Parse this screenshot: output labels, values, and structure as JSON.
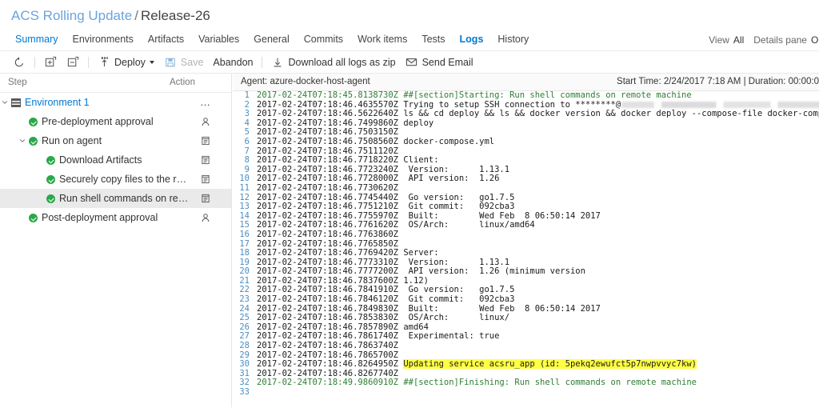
{
  "breadcrumb": {
    "project": "ACS Rolling Update",
    "separator": "/",
    "current": "Release-26"
  },
  "tabs": [
    {
      "label": "Summary",
      "state": "link"
    },
    {
      "label": "Environments",
      "state": "normal"
    },
    {
      "label": "Artifacts",
      "state": "normal"
    },
    {
      "label": "Variables",
      "state": "normal"
    },
    {
      "label": "General",
      "state": "normal"
    },
    {
      "label": "Commits",
      "state": "normal"
    },
    {
      "label": "Work items",
      "state": "normal"
    },
    {
      "label": "Tests",
      "state": "normal"
    },
    {
      "label": "Logs",
      "state": "active"
    },
    {
      "label": "History",
      "state": "normal"
    }
  ],
  "tab_right": {
    "view_label": "View",
    "view_value": "All",
    "details_pane_label": "Details pane",
    "details_pane_value": "On"
  },
  "toolbar": {
    "refresh_icon": "refresh-icon",
    "expand_all_icon": "expand-all-icon",
    "collapse_all_icon": "collapse-all-icon",
    "deploy_label": "Deploy",
    "deploy_icon": "deploy-icon",
    "save_label": "Save",
    "save_icon": "save-icon",
    "abandon_label": "Abandon",
    "download_label": "Download all logs as zip",
    "download_icon": "download-icon",
    "send_email_label": "Send Email",
    "send_email_icon": "mail-icon"
  },
  "tree": {
    "col_step": "Step",
    "col_action": "Action",
    "nodes": [
      {
        "label": "Environment 1",
        "indent": 14,
        "chevron": "down",
        "icon": "environment-icon",
        "action": "more-icon",
        "selected": false,
        "kind": "env"
      },
      {
        "label": "Pre-deployment approval",
        "indent": 36,
        "chevron": "",
        "icon": "success-icon",
        "action": "person-icon",
        "selected": false,
        "kind": "task"
      },
      {
        "label": "Run on agent",
        "indent": 36,
        "chevron": "down",
        "icon": "success-icon",
        "action": "task-icon",
        "selected": false,
        "kind": "task"
      },
      {
        "label": "Download Artifacts",
        "indent": 58,
        "chevron": "",
        "icon": "success-icon",
        "action": "task-icon",
        "selected": false,
        "kind": "task"
      },
      {
        "label": "Securely copy files to the remote mac…",
        "indent": 58,
        "chevron": "",
        "icon": "success-icon",
        "action": "task-icon",
        "selected": false,
        "kind": "task"
      },
      {
        "label": "Run shell commands on remote mach…",
        "indent": 58,
        "chevron": "",
        "icon": "success-icon",
        "action": "task-icon",
        "selected": true,
        "kind": "task"
      },
      {
        "label": "Post-deployment approval",
        "indent": 36,
        "chevron": "",
        "icon": "success-icon",
        "action": "person-icon",
        "selected": false,
        "kind": "task"
      }
    ]
  },
  "log": {
    "agent": "Agent: azure-docker-host-agent",
    "meta": "Start Time: 2/24/2017 7:18 AM | Duration: 00:00:0",
    "lines": [
      {
        "n": "1",
        "ts": "2017-02-24T07:18:45.8138730Z ",
        "text": "##[section]Starting: Run shell commands on remote machine",
        "style": "green"
      },
      {
        "n": "2",
        "ts": "2017-02-24T07:18:46.4635570Z ",
        "text": "Trying to setup SSH connection to ********@",
        "style": "plain",
        "redacted": true
      },
      {
        "n": "3",
        "ts": "2017-02-24T07:18:46.5622640Z ",
        "text": "ls && cd deploy && ls && docker version && docker deploy --compose-file docker-compose.yml acsru",
        "style": "plain"
      },
      {
        "n": "4",
        "ts": "2017-02-24T07:18:46.7499860Z ",
        "text": "deploy",
        "style": "plain"
      },
      {
        "n": "5",
        "ts": "2017-02-24T07:18:46.7503150Z ",
        "text": "",
        "style": "plain"
      },
      {
        "n": "6",
        "ts": "2017-02-24T07:18:46.7508560Z ",
        "text": "docker-compose.yml",
        "style": "plain"
      },
      {
        "n": "7",
        "ts": "2017-02-24T07:18:46.7511120Z ",
        "text": "",
        "style": "plain"
      },
      {
        "n": "8",
        "ts": "2017-02-24T07:18:46.7718220Z ",
        "text": "Client:",
        "style": "plain"
      },
      {
        "n": "9",
        "ts": "2017-02-24T07:18:46.7723240Z ",
        "text": " Version:      1.13.1",
        "style": "plain"
      },
      {
        "n": "10",
        "ts": "2017-02-24T07:18:46.7728000Z ",
        "text": " API version:  1.26",
        "style": "plain"
      },
      {
        "n": "11",
        "ts": "2017-02-24T07:18:46.7730620Z ",
        "text": "",
        "style": "plain"
      },
      {
        "n": "12",
        "ts": "2017-02-24T07:18:46.7745440Z ",
        "text": " Go version:   go1.7.5",
        "style": "plain"
      },
      {
        "n": "13",
        "ts": "2017-02-24T07:18:46.7751210Z ",
        "text": " Git commit:   092cba3",
        "style": "plain"
      },
      {
        "n": "14",
        "ts": "2017-02-24T07:18:46.7755970Z ",
        "text": " Built:        Wed Feb  8 06:50:14 2017",
        "style": "plain"
      },
      {
        "n": "15",
        "ts": "2017-02-24T07:18:46.7761620Z ",
        "text": " OS/Arch:      linux/amd64",
        "style": "plain"
      },
      {
        "n": "16",
        "ts": "2017-02-24T07:18:46.7763860Z ",
        "text": "",
        "style": "plain"
      },
      {
        "n": "17",
        "ts": "2017-02-24T07:18:46.7765850Z ",
        "text": "",
        "style": "plain"
      },
      {
        "n": "18",
        "ts": "2017-02-24T07:18:46.7769420Z ",
        "text": "Server:",
        "style": "plain"
      },
      {
        "n": "19",
        "ts": "2017-02-24T07:18:46.7773310Z ",
        "text": " Version:      1.13.1",
        "style": "plain"
      },
      {
        "n": "20",
        "ts": "2017-02-24T07:18:46.7777200Z ",
        "text": " API version:  1.26 (minimum version",
        "style": "plain"
      },
      {
        "n": "21",
        "ts": "2017-02-24T07:18:46.7837600Z ",
        "text": "1.12)",
        "style": "plain"
      },
      {
        "n": "22",
        "ts": "2017-02-24T07:18:46.7841910Z ",
        "text": " Go version:   go1.7.5",
        "style": "plain"
      },
      {
        "n": "23",
        "ts": "2017-02-24T07:18:46.7846120Z ",
        "text": " Git commit:   092cba3",
        "style": "plain"
      },
      {
        "n": "24",
        "ts": "2017-02-24T07:18:46.7849830Z ",
        "text": " Built:        Wed Feb  8 06:50:14 2017",
        "style": "plain"
      },
      {
        "n": "25",
        "ts": "2017-02-24T07:18:46.7853830Z ",
        "text": " OS/Arch:      linux/",
        "style": "plain"
      },
      {
        "n": "26",
        "ts": "2017-02-24T07:18:46.7857890Z ",
        "text": "amd64",
        "style": "plain"
      },
      {
        "n": "27",
        "ts": "2017-02-24T07:18:46.7861740Z ",
        "text": " Experimental: true",
        "style": "plain"
      },
      {
        "n": "28",
        "ts": "2017-02-24T07:18:46.7863740Z ",
        "text": "",
        "style": "plain"
      },
      {
        "n": "29",
        "ts": "2017-02-24T07:18:46.7865700Z ",
        "text": "",
        "style": "plain"
      },
      {
        "n": "30",
        "ts": "2017-02-24T07:18:46.8264950Z ",
        "text": "Updating service acsru_app (id: 5pekq2ewufct5p7nwpvvyc7kw)",
        "style": "plain",
        "highlight": true
      },
      {
        "n": "31",
        "ts": "2017-02-24T07:18:46.8267740Z ",
        "text": "",
        "style": "plain"
      },
      {
        "n": "32",
        "ts": "2017-02-24T07:18:49.9860910Z ",
        "text": "##[section]Finishing: Run shell commands on remote machine",
        "style": "green"
      },
      {
        "n": "33",
        "ts": "",
        "text": "",
        "style": "plain"
      }
    ]
  },
  "colors": {
    "accent": "#0078d4",
    "link": "#6aa4dd",
    "success": "#2aa84a",
    "log_green": "#2e7d32",
    "line_number": "#4a8ec2",
    "highlight": "#ffff44",
    "selected_row": "#eaeaea"
  }
}
